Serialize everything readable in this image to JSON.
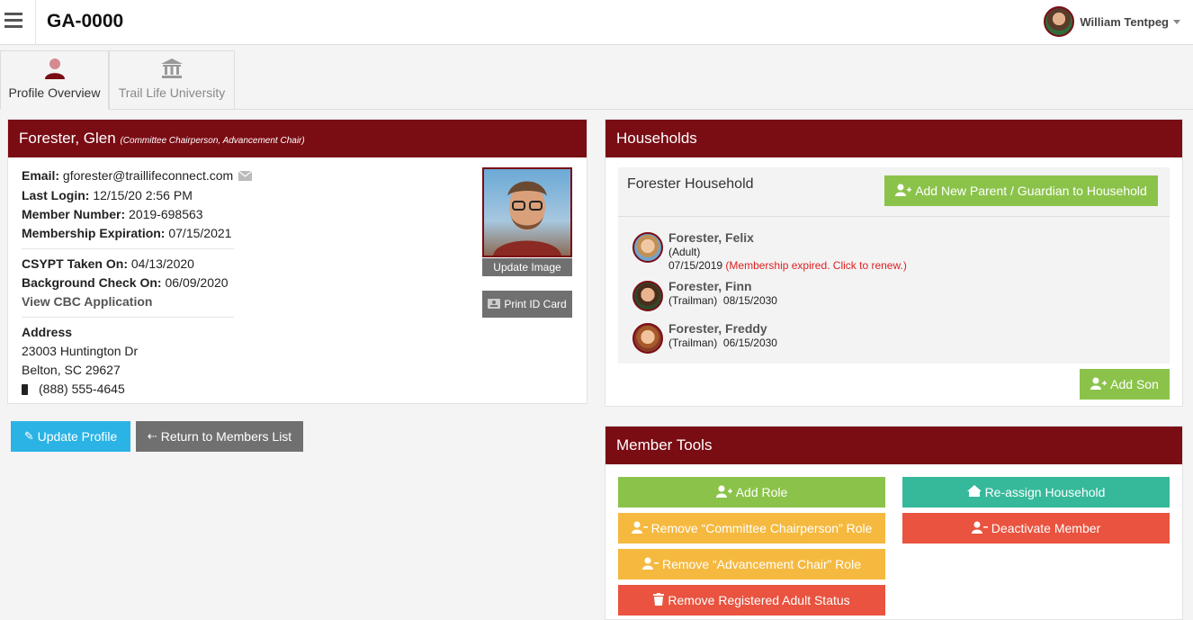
{
  "header": {
    "title": "GA-0000",
    "user_name": "William Tentpeg"
  },
  "tabs": [
    {
      "label": "Profile Overview",
      "icon": "user-icon"
    },
    {
      "label": "Trail Life University",
      "icon": "institution-icon"
    }
  ],
  "profile": {
    "name": "Forester, Glen",
    "roles": "(Committee Chairperson, Advancement Chair)",
    "email_label": "Email:",
    "email": "gforester@traillifeconnect.com",
    "last_login_label": "Last Login:",
    "last_login": "12/15/20 2:56 PM",
    "member_number_label": "Member Number:",
    "member_number": "2019-698563",
    "expiration_label": "Membership Expiration:",
    "expiration": "07/15/2021",
    "csypt_label": "CSYPT Taken On:",
    "csypt": "04/13/2020",
    "background_label": "Background Check On:",
    "background": "06/09/2020",
    "cbc_link": "View CBC Application",
    "address_label": "Address",
    "address_line1": "23003 Huntington Dr",
    "address_line2": "Belton, SC 29627",
    "phone": "(888) 555-4645",
    "update_image": "Update Image",
    "print_id": "Print ID Card"
  },
  "actions": {
    "update_profile": "Update Profile",
    "return_list": "Return to Members List"
  },
  "households": {
    "title": "Households",
    "household_name": "Forester Household",
    "add_parent": "Add New Parent / Guardian to Household",
    "members": [
      {
        "name": "Forester, Felix",
        "role": "(Adult)",
        "date": "07/15/2019",
        "note": "(Membership expired. Click to renew.)"
      },
      {
        "name": "Forester, Finn",
        "role": "(Trailman)",
        "date": "08/15/2030"
      },
      {
        "name": "Forester, Freddy",
        "role": "(Trailman)",
        "date": "06/15/2030"
      }
    ],
    "add_son": "Add Son"
  },
  "tools": {
    "title": "Member Tools",
    "add_role": "Add Role",
    "reassign": "Re-assign Household",
    "remove_committee": "Remove “Committee Chairperson” Role",
    "deactivate": "Deactivate Member",
    "remove_advancement": "Remove “Advancement Chair” Role",
    "remove_adult": "Remove Registered Adult Status"
  },
  "colors": {
    "brand": "#7a0c14",
    "green": "#8bc34a",
    "yellow": "#f5b940",
    "red": "#e9533f",
    "teal": "#35b99a",
    "blue": "#2bb3e5"
  }
}
